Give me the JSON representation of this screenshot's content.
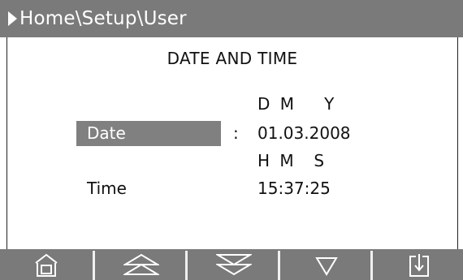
{
  "header": {
    "breadcrumb": "Home\\Setup\\User"
  },
  "main": {
    "title": "DATE AND TIME",
    "date": {
      "label": "Date",
      "separator": ":",
      "format_header": "D M   Y",
      "value": "01.03.2008"
    },
    "time": {
      "label": "Time",
      "format_header": "H M  S",
      "value": "15:37:25"
    }
  },
  "footer": {
    "buttons": [
      {
        "icon": "home-icon"
      },
      {
        "icon": "page-up-icon"
      },
      {
        "icon": "page-down-icon"
      },
      {
        "icon": "down-arrow-icon"
      },
      {
        "icon": "enter-icon"
      }
    ]
  },
  "colors": {
    "bar": "#7a7a7a",
    "selection": "#808080",
    "background": "#ffffff"
  }
}
